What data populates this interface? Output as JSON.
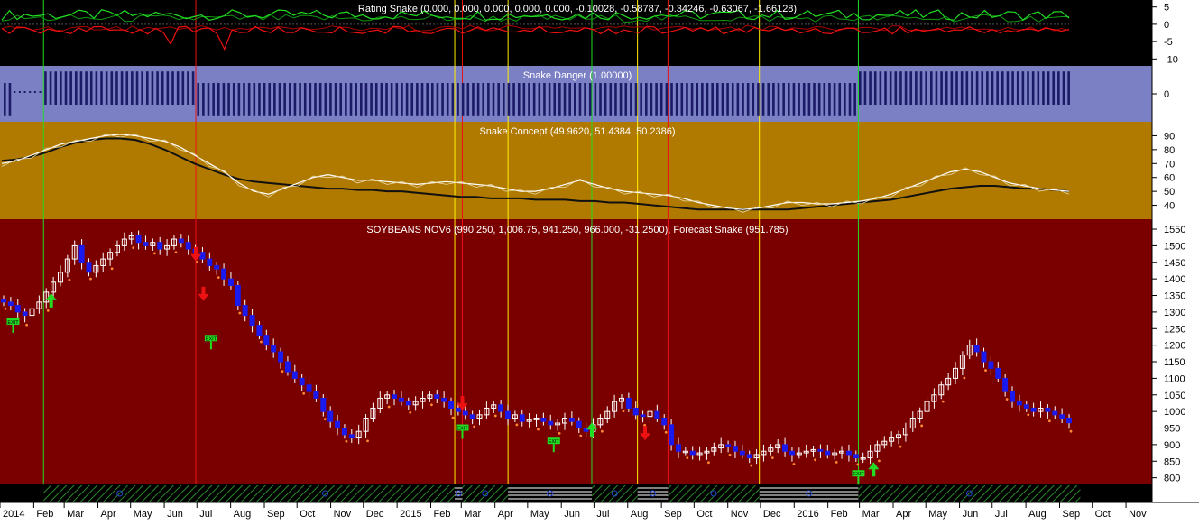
{
  "colors": {
    "rating_bg": "#000000",
    "danger_bg": "#7b7fc4",
    "concept_bg": "#b07a00",
    "price_bg": "#7a0000",
    "axis_bg": "#ffffff",
    "green": "#22dd22",
    "red": "#ee1111",
    "blue": "#1a1aee",
    "navy": "#1a1a66",
    "yellow": "#ffee00",
    "white": "#ffffff",
    "orange": "#ff8833",
    "dark_line": "#101010"
  },
  "panels": {
    "rating": {
      "title": "Rating Snake (0.000, 0.000, 0.000, 0.000, 0.000, -0.10028, -0.58787, -0.34246, -0.63067, -1.66128)",
      "ticks": [
        5,
        0,
        -5,
        -10
      ]
    },
    "danger": {
      "title": "Snake Danger (1.00000)",
      "ticks": [
        0
      ]
    },
    "concept": {
      "title": "Snake Concept (49.9620, 51.4384, 50.2386)",
      "ticks": [
        90,
        80,
        70,
        60,
        50,
        40
      ]
    },
    "price": {
      "title": "SOYBEANS NOV6 (990.250, 1,006.75, 941.250, 966.000, -31.2500), Forecast Snake (951.785)",
      "ticks": [
        1550,
        1500,
        1450,
        1400,
        1350,
        1300,
        1250,
        1200,
        1150,
        1100,
        1050,
        1000,
        950,
        900,
        850,
        800
      ]
    }
  },
  "chart_data": {
    "type": "line",
    "symbol": "SOYBEANS NOV6",
    "x_range": [
      "2014-01",
      "2016-11"
    ],
    "x_ticks": [
      "2014",
      "Feb",
      "Mar",
      "Apr",
      "May",
      "Jun",
      "Jul",
      "Aug",
      "Sep",
      "Oct",
      "Nov",
      "Dec",
      "2015",
      "Feb",
      "Mar",
      "Apr",
      "May",
      "Jun",
      "Jul",
      "Aug",
      "Sep",
      "Oct",
      "Nov",
      "Dec",
      "2016",
      "Feb",
      "Mar",
      "Apr",
      "May",
      "Jun",
      "Jul",
      "Aug",
      "Sep",
      "Oct",
      "Nov"
    ],
    "price_ylim": [
      780,
      1580
    ],
    "price_weekly_close": [
      1330,
      1320,
      1300,
      1290,
      1310,
      1330,
      1360,
      1390,
      1420,
      1460,
      1500,
      1450,
      1420,
      1440,
      1460,
      1480,
      1500,
      1520,
      1530,
      1510,
      1500,
      1510,
      1490,
      1500,
      1520,
      1510,
      1490,
      1480,
      1460,
      1440,
      1430,
      1400,
      1380,
      1320,
      1290,
      1260,
      1230,
      1200,
      1180,
      1150,
      1120,
      1100,
      1080,
      1060,
      1040,
      1000,
      970,
      950,
      930,
      920,
      940,
      980,
      1010,
      1040,
      1050,
      1040,
      1030,
      1020,
      1030,
      1040,
      1050,
      1040,
      1030,
      1010,
      1000,
      990,
      980,
      990,
      1010,
      1020,
      1000,
      980,
      990,
      970,
      975,
      980,
      970,
      960,
      965,
      980,
      970,
      950,
      940,
      960,
      980,
      1000,
      1030,
      1040,
      1010,
      990,
      985,
      1000,
      980,
      960,
      900,
      880,
      880,
      870,
      875,
      880,
      890,
      900,
      895,
      880,
      870,
      860,
      870,
      880,
      890,
      900,
      880,
      870,
      875,
      880,
      885,
      880,
      870,
      875,
      880,
      870,
      860,
      860,
      880,
      900,
      910,
      920,
      930,
      950,
      980,
      1000,
      1030,
      1050,
      1080,
      1100,
      1130,
      1170,
      1200,
      1180,
      1150,
      1130,
      1100,
      1060,
      1030,
      1020,
      1010,
      1000,
      1010,
      1000,
      990,
      980,
      966
    ],
    "forecast_snake": {
      "name": "Forecast Snake",
      "last": 951.785
    },
    "concept_ylim": [
      30,
      100
    ],
    "concept_fast": [
      70,
      72,
      76,
      80,
      84,
      86,
      88,
      90,
      91,
      90,
      88,
      86,
      82,
      76,
      70,
      64,
      56,
      50,
      48,
      52,
      56,
      60,
      62,
      60,
      58,
      58,
      57,
      56,
      55,
      56,
      57,
      56,
      55,
      54,
      52,
      50,
      50,
      52,
      55,
      58,
      55,
      52,
      50,
      49,
      48,
      47,
      45,
      42,
      40,
      38,
      37,
      38,
      40,
      42,
      42,
      41,
      41,
      42,
      43,
      45,
      48,
      52,
      56,
      60,
      64,
      66,
      64,
      60,
      56,
      54,
      52,
      51,
      50
    ],
    "concept_slow": [
      72,
      73,
      75,
      78,
      82,
      85,
      87,
      88,
      88,
      87,
      84,
      80,
      75,
      70,
      66,
      62,
      59,
      57,
      56,
      55,
      54,
      53,
      52,
      52,
      51,
      51,
      50,
      50,
      49,
      48,
      47,
      46,
      46,
      45,
      45,
      45,
      44,
      44,
      44,
      43,
      43,
      42,
      42,
      41,
      40,
      39,
      38,
      37,
      37,
      37,
      37,
      37,
      37,
      37,
      38,
      39,
      40,
      41,
      42,
      43,
      44,
      46,
      48,
      50,
      52,
      53,
      54,
      54,
      53,
      52,
      52,
      51,
      50
    ],
    "rating_last": [
      0.0,
      0.0,
      0.0,
      0.0,
      0.0,
      -0.10028,
      -0.58787,
      -0.34246,
      -0.63067,
      -1.66128
    ],
    "danger_value": 1.0,
    "vertical_markers": [
      {
        "color": "green",
        "x": "2014-02-10"
      },
      {
        "color": "red",
        "x": "2014-06-30"
      },
      {
        "color": "yellow",
        "x": "2015-02-23"
      },
      {
        "color": "red",
        "x": "2015-03-02"
      },
      {
        "color": "yellow",
        "x": "2015-04-13"
      },
      {
        "color": "green",
        "x": "2015-06-29"
      },
      {
        "color": "yellow",
        "x": "2015-08-10"
      },
      {
        "color": "red",
        "x": "2015-09-07"
      },
      {
        "color": "yellow",
        "x": "2015-11-30"
      },
      {
        "color": "green",
        "x": "2016-02-29"
      }
    ],
    "signals": [
      {
        "kind": "buy",
        "x": "2014-02-17",
        "y": 1330
      },
      {
        "kind": "sell",
        "x": "2014-06-30",
        "y": 1480
      },
      {
        "kind": "sell",
        "x": "2014-07-07",
        "y": 1360
      },
      {
        "kind": "sell",
        "x": "2015-03-02",
        "y": 1030
      },
      {
        "kind": "buy",
        "x": "2015-06-29",
        "y": 940
      },
      {
        "kind": "sell",
        "x": "2015-08-17",
        "y": 940
      },
      {
        "kind": "buy",
        "x": "2016-03-14",
        "y": 820
      }
    ],
    "exit_labels": [
      {
        "text": "EXIT",
        "x": "2014-01-13",
        "y": 1270
      },
      {
        "text": "EXIT",
        "x": "2014-07-14",
        "y": 1220
      },
      {
        "text": "EXIT",
        "x": "2015-03-02",
        "y": 950
      },
      {
        "text": "EXIT",
        "x": "2015-05-25",
        "y": 910
      },
      {
        "text": "EXIT",
        "x": "2016-02-29",
        "y": 812
      }
    ]
  }
}
